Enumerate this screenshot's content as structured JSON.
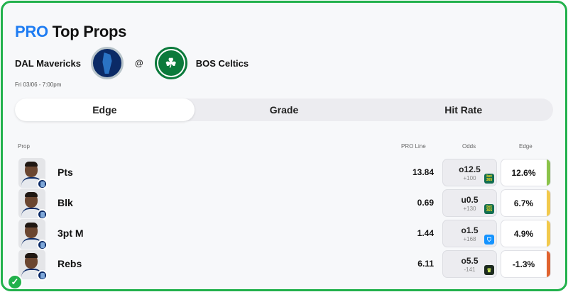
{
  "title": {
    "pro": "PRO",
    "rest": "Top Props"
  },
  "matchup": {
    "away_team": "DAL Mavericks",
    "at": "@",
    "home_team": "BOS Celtics",
    "home_logo_text": "☘",
    "datetime": "Fri 03/06 - 7:00pm"
  },
  "tabs": [
    {
      "label": "Edge",
      "active": true
    },
    {
      "label": "Grade",
      "active": false
    },
    {
      "label": "Hit Rate",
      "active": false
    }
  ],
  "columns": {
    "prop": "Prop",
    "pro_line": "PRO Line",
    "odds": "Odds",
    "edge": "Edge"
  },
  "rows": [
    {
      "prop": "Pts",
      "pro_line": "13.84",
      "odds_main": "o12.5",
      "odds_sub": "+100",
      "book": "bet365",
      "book_text": "bet 365",
      "edge": "12.6%",
      "edge_color": "#8bc34a"
    },
    {
      "prop": "Blk",
      "pro_line": "0.69",
      "odds_main": "u0.5",
      "odds_sub": "+130",
      "book": "bet365",
      "book_text": "bet 365",
      "edge": "6.7%",
      "edge_color": "#f2c94c"
    },
    {
      "prop": "3pt M",
      "pro_line": "1.44",
      "odds_main": "o1.5",
      "odds_sub": "+168",
      "book": "fanduel",
      "book_text": "⛉",
      "edge": "4.9%",
      "edge_color": "#f2c94c"
    },
    {
      "prop": "Rebs",
      "pro_line": "6.11",
      "odds_main": "o5.5",
      "odds_sub": "-141",
      "book": "draftkings",
      "book_text": "♛",
      "edge": "-1.3%",
      "edge_color": "#e0632f"
    }
  ],
  "status_icon": "check-circle-icon",
  "colors": {
    "accent": "#1e7cf2",
    "border": "#22b14c"
  }
}
